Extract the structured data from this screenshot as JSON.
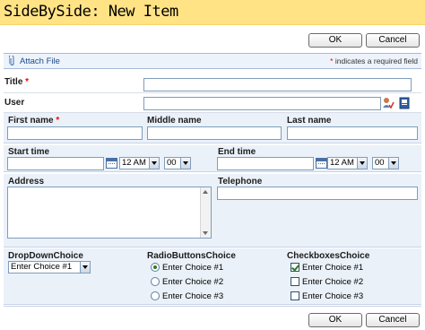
{
  "window": {
    "title": "SideBySide: New Item"
  },
  "toolbar": {
    "ok_label": "OK",
    "cancel_label": "Cancel"
  },
  "attach": {
    "label": "Attach File",
    "required_star": "*",
    "required_note": "indicates a required field"
  },
  "fields": {
    "title": {
      "label": "Title",
      "required": "*",
      "value": ""
    },
    "user": {
      "label": "User",
      "value": ""
    },
    "first_name": {
      "label": "First name",
      "required": "*",
      "value": ""
    },
    "middle_name": {
      "label": "Middle name",
      "value": ""
    },
    "last_name": {
      "label": "Last name",
      "value": ""
    },
    "start_time": {
      "label": "Start time",
      "date": "",
      "hour": "12 AM",
      "minute": "00"
    },
    "end_time": {
      "label": "End time",
      "date": "",
      "hour": "12 AM",
      "minute": "00"
    },
    "address": {
      "label": "Address",
      "value": ""
    },
    "telephone": {
      "label": "Telephone",
      "value": ""
    },
    "dropdown": {
      "label": "DropDownChoice",
      "selected": "Enter Choice #1"
    },
    "radio": {
      "label": "RadioButtonsChoice",
      "options": [
        "Enter Choice #1",
        "Enter Choice #2",
        "Enter Choice #3"
      ],
      "selected_index": 0
    },
    "checkboxes": {
      "label": "CheckboxesChoice",
      "options": [
        "Enter Choice #1",
        "Enter Choice #2",
        "Enter Choice #3"
      ],
      "checked": [
        true,
        false,
        false
      ]
    }
  },
  "colors": {
    "titlebar_bg": "#ffe385",
    "panel_bg": "#ebf1f9",
    "link": "#1c4a8c",
    "required": "#ff0000"
  }
}
